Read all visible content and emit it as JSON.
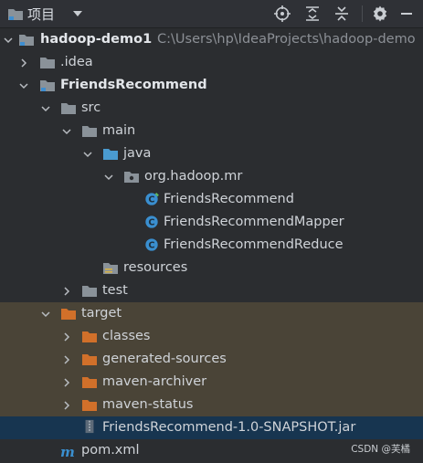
{
  "header": {
    "title": "项目",
    "icons": [
      "folder-icon",
      "chevron-down-icon",
      "locate-icon",
      "expand-all-icon",
      "collapse-all-icon",
      "gear-icon",
      "minimize-icon"
    ]
  },
  "tree": {
    "root": {
      "label": "hadoop-demo1",
      "path": "C:\\Users\\hp\\IdeaProjects\\hadoop-demo"
    },
    "idea": "idea",
    "idea_prefix": ".",
    "module": "FriendsRecommend",
    "src": "src",
    "main": "main",
    "java": "java",
    "package": "org.hadoop.mr",
    "classes": [
      "FriendsRecommend",
      "FriendsRecommendMapper",
      "FriendsRecommendReduce"
    ],
    "resources": "resources",
    "test": "test",
    "target": "target",
    "target_children": [
      "classes",
      "generated-sources",
      "maven-archiver",
      "maven-status"
    ],
    "jar": "FriendsRecommend-1.0-SNAPSHOT.jar",
    "pom": "pom.xml"
  },
  "watermark": "CSDN @芙橘",
  "colors": {
    "background": "#2b2d30",
    "target_highlight": "#4a4437",
    "selection": "#173550",
    "folder": "#8a9299",
    "source_folder": "#4a9bd0",
    "excluded_folder": "#d1702a",
    "class_icon": "#3a8fd0"
  }
}
